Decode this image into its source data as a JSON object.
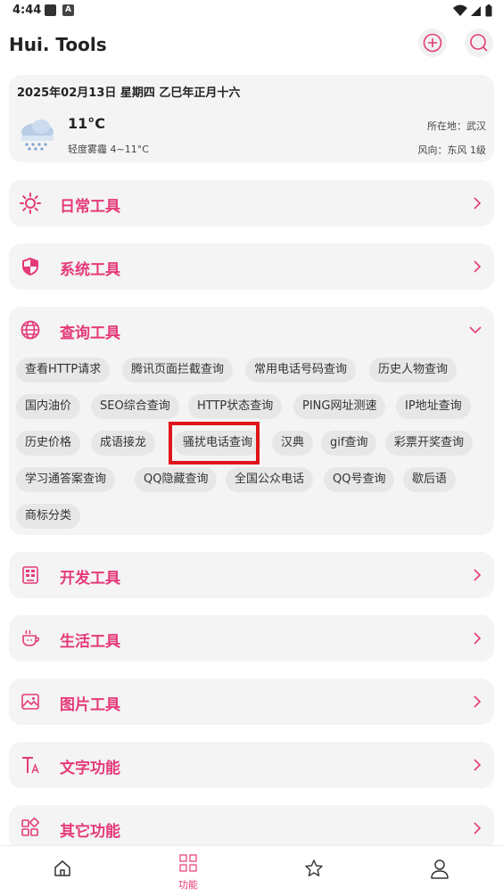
{
  "status_bar": {
    "time": "4:44",
    "notif_icon_label": "A"
  },
  "app": {
    "title": "Hui. Tools"
  },
  "weather": {
    "date": "2025年02月13日   星期四   乙巳年正月十六",
    "temperature": "11°C",
    "description": "轻度雾霾 4~11°C",
    "location": "所在地：武汉",
    "wind": "风向：东风 1级",
    "icon": "snow-cloud-icon"
  },
  "categories": [
    {
      "id": "daily",
      "label": "日常工具",
      "icon": "sun-icon"
    },
    {
      "id": "system",
      "label": "系统工具",
      "icon": "shield-icon"
    },
    {
      "id": "query",
      "label": "查询工具",
      "icon": "globe-icon",
      "expanded": true,
      "items": [
        "查看HTTP请求",
        "腾讯页面拦截查询",
        "常用电话号码查询",
        "历史人物查询",
        "国内油价",
        "SEO综合查询",
        "HTTP状态查询",
        "PING网址测速",
        "IP地址查询",
        "历史价格",
        "成语接龙",
        "骚扰电话查询",
        "汉典",
        "gif查询",
        "彩票开奖查询",
        "学习通答案查询",
        "QQ隐藏查询",
        "全国公众电话",
        "QQ号查询",
        "歇后语",
        "商标分类"
      ]
    },
    {
      "id": "dev",
      "label": "开发工具",
      "icon": "chip-icon"
    },
    {
      "id": "life",
      "label": "生活工具",
      "icon": "cup-icon"
    },
    {
      "id": "image",
      "label": "图片工具",
      "icon": "image-icon"
    },
    {
      "id": "text",
      "label": "文字功能",
      "icon": "text-icon"
    },
    {
      "id": "other",
      "label": "其它功能",
      "icon": "apps-icon"
    }
  ],
  "bottom_nav": {
    "items": [
      {
        "icon": "home-icon",
        "label": ""
      },
      {
        "icon": "grid-icon",
        "label": "功能",
        "active": true
      },
      {
        "icon": "star-icon",
        "label": ""
      },
      {
        "icon": "user-icon",
        "label": ""
      }
    ]
  },
  "colors": {
    "accent": "#e53a79",
    "card": "#f4f4f4",
    "chip": "#e7e7e7",
    "highlight": "#e0151a"
  }
}
